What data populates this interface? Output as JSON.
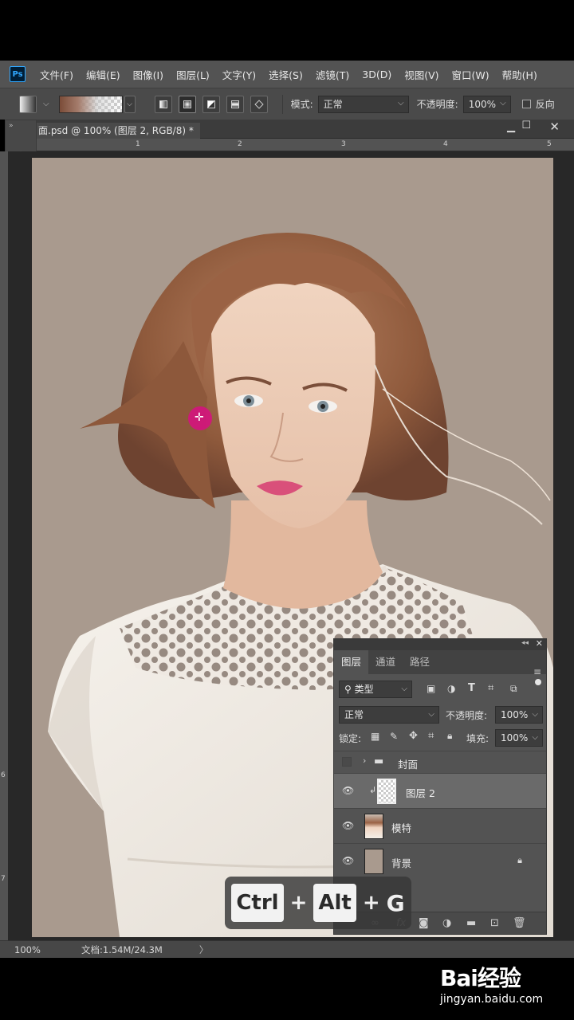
{
  "app": {
    "logo": "Ps"
  },
  "menu": [
    "文件(F)",
    "编辑(E)",
    "图像(I)",
    "图层(L)",
    "文字(Y)",
    "选择(S)",
    "滤镜(T)",
    "3D(D)",
    "视图(V)",
    "窗口(W)",
    "帮助(H)"
  ],
  "options": {
    "mode_label": "模式:",
    "mode_value": "正常",
    "opacity_label": "不透明度:",
    "opacity_value": "100%",
    "reverse_label": "反向"
  },
  "document": {
    "title": "面.psd @ 100% (图层 2, RGB/8) *",
    "ruler_top": [
      "1",
      "2",
      "3",
      "4",
      "5"
    ],
    "ruler_left": [
      "6",
      "7"
    ]
  },
  "layers_panel": {
    "tabs": [
      "图层",
      "通道",
      "路径"
    ],
    "filter_kind": "类型",
    "blend_mode": "正常",
    "opacity_label": "不透明度:",
    "opacity_value": "100%",
    "lock_label": "锁定:",
    "fill_label": "填充:",
    "fill_value": "100%",
    "layers": [
      {
        "name": "封面",
        "type": "group",
        "visible": false
      },
      {
        "name": "图层 2",
        "type": "clipped",
        "visible": true,
        "selected": true
      },
      {
        "name": "模特",
        "type": "image",
        "visible": true
      },
      {
        "name": "背景",
        "type": "background",
        "visible": true,
        "locked": true
      }
    ],
    "footer_icons": [
      "link-icon",
      "fx-icon",
      "mask-icon",
      "adjustment-icon",
      "folder-icon",
      "new-layer-icon",
      "trash-icon"
    ]
  },
  "status": {
    "zoom": "100%",
    "doc_info": "文档:1.54M/24.3M",
    "arrow": "〉"
  },
  "shortcut_overlay": {
    "key1": "Ctrl",
    "plus": "+",
    "key2": "Alt",
    "key3": "G"
  },
  "watermark": {
    "brand": "Bai经验",
    "url": "jingyan.baidu.com"
  },
  "colors": {
    "foreground": "#7a4a38",
    "background": "#000000",
    "canvas_bg": "#a99a8e",
    "cursor": "#d4147e"
  }
}
